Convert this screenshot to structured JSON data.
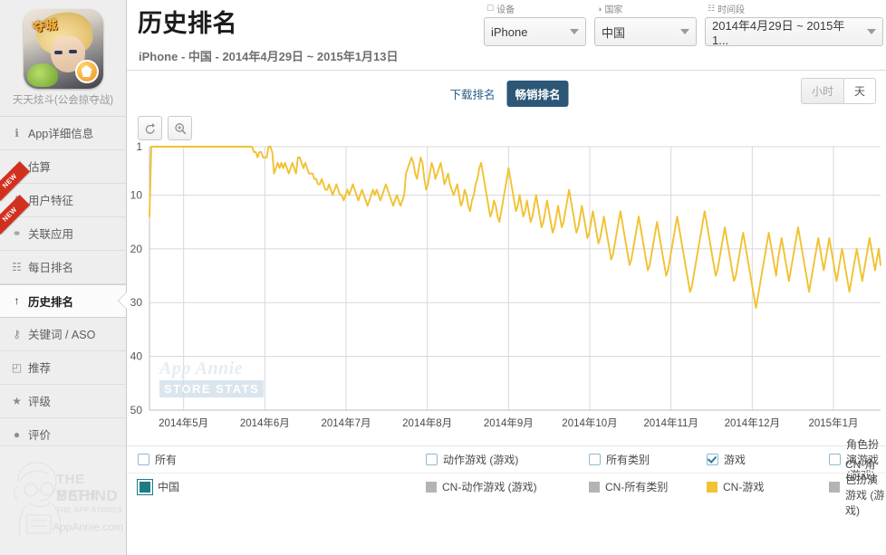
{
  "sidebar": {
    "app_name": "天天炫斗(公会掠夺战)",
    "app_icon_banner": "夺城",
    "items": [
      {
        "label": "App详细信息",
        "icon": "info-icon",
        "glyph": "ℹ",
        "new": false,
        "active": false
      },
      {
        "label": "估算",
        "icon": "chart-line-icon",
        "glyph": "↗",
        "new": false,
        "active": false
      },
      {
        "label": "用户特征",
        "icon": "user-icon",
        "glyph": "♟",
        "new": true,
        "active": false
      },
      {
        "label": "关联应用",
        "icon": "link-apps-icon",
        "glyph": "⚭",
        "new": true,
        "active": false
      },
      {
        "label": "每日排名",
        "icon": "calendar-icon",
        "glyph": "☷",
        "new": false,
        "active": false
      },
      {
        "label": "历史排名",
        "icon": "up-arrow-icon",
        "glyph": "↑",
        "new": false,
        "active": true
      },
      {
        "label": "关键词 / ASO",
        "icon": "key-icon",
        "glyph": "⚷",
        "new": false,
        "active": false
      },
      {
        "label": "推荐",
        "icon": "bookmark-icon",
        "glyph": "◰",
        "new": false,
        "active": false
      },
      {
        "label": "评级",
        "icon": "star-icon",
        "glyph": "★",
        "new": false,
        "active": false
      },
      {
        "label": "评价",
        "icon": "comment-icon",
        "glyph": "●",
        "new": false,
        "active": false
      }
    ],
    "brand": {
      "line1": "THE MATH",
      "line2": "BEHIND",
      "line3": "THE APP STORES",
      "line4": "AppAnnie.com"
    },
    "new_badge_text": "NEW"
  },
  "header": {
    "title": "历史排名",
    "subtitle": "iPhone - 中国 - 2014年4月29日 ~ 2015年1月13日",
    "selectors": [
      {
        "label": "设备",
        "icon": "device-icon",
        "glyph": "☐",
        "value": "iPhone",
        "width": "sel-w1"
      },
      {
        "label": "国家",
        "icon": "globe-icon",
        "glyph": "◑",
        "value": "中国",
        "width": "sel-w2"
      },
      {
        "label": "时间段",
        "icon": "calendar-icon",
        "glyph": "☷",
        "value": "2014年4月29日 ~ 2015年1...",
        "width": "sel-w3"
      }
    ]
  },
  "toolbar": {
    "tabs": [
      {
        "label": "下载排名",
        "active": false
      },
      {
        "label": "畅销排名",
        "active": true
      }
    ],
    "units": [
      {
        "label": "小时",
        "active": false
      },
      {
        "label": "天",
        "active": true
      }
    ],
    "chart_buttons": [
      {
        "name": "reset-zoom-button",
        "icon": "undo-icon"
      },
      {
        "name": "zoom-in-button",
        "icon": "magnifier-plus-icon"
      }
    ]
  },
  "watermark": {
    "line1": "App Annie",
    "line2": "STORE STATS"
  },
  "legend": {
    "checkboxes": [
      {
        "label": "所有",
        "checked": false
      },
      {
        "label": "动作游戏 (游戏)",
        "checked": false
      },
      {
        "label": "所有类别",
        "checked": false
      },
      {
        "label": "游戏",
        "checked": true
      },
      {
        "label": "角色扮演游戏 (游戏)",
        "checked": false
      }
    ],
    "series_legend": [
      {
        "label": "中国",
        "color": "#1d7b86",
        "style": "teal"
      },
      {
        "label": "CN-动作游戏 (游戏)",
        "color": "#b4b4b4",
        "style": "flat"
      },
      {
        "label": "CN-所有类别",
        "color": "#b4b4b4",
        "style": "flat"
      },
      {
        "label": "CN-游戏",
        "color": "#f1c232",
        "style": "flat"
      },
      {
        "label": "CN-角色扮演游戏 (游戏)",
        "color": "#b4b4b4",
        "style": "flat"
      }
    ]
  },
  "chart_data": {
    "type": "line",
    "title": "历史排名",
    "xlabel": "",
    "ylabel": "",
    "ylim": [
      1,
      50
    ],
    "y_inverted": true,
    "yticks": [
      1,
      10,
      20,
      30,
      40,
      50
    ],
    "xticks": [
      "2014年5月",
      "2014年6月",
      "2014年7月",
      "2014年8月",
      "2014年9月",
      "2014年10月",
      "2014年11月",
      "2014年12月",
      "2015年1月"
    ],
    "x_range": [
      "2014年4月29日",
      "2015年1月13日"
    ],
    "grid": true,
    "legend_position": "bottom",
    "line_color": "#f1c232",
    "series": [
      {
        "name": "CN-游戏",
        "color": "#f1c232",
        "values": [
          14,
          1,
          1,
          1,
          1,
          1,
          1,
          1,
          1,
          1,
          1,
          1,
          1,
          1,
          1,
          1,
          1,
          1,
          1,
          1,
          1,
          1,
          1,
          1,
          1,
          1,
          1,
          1,
          1,
          1,
          1,
          1,
          1,
          1,
          1,
          1,
          1,
          1,
          1,
          1,
          1,
          1,
          1,
          1,
          1,
          1,
          1,
          1,
          1,
          1,
          1,
          1,
          1,
          1,
          1,
          1,
          1,
          2,
          2,
          3,
          2,
          2,
          3,
          3,
          3,
          1,
          1,
          2,
          6,
          5,
          4,
          5,
          4,
          5,
          4,
          5,
          6,
          5,
          4,
          5,
          6,
          3,
          3,
          4,
          5,
          4,
          5,
          6,
          6,
          6,
          7,
          7,
          8,
          8,
          7,
          8,
          9,
          9,
          8,
          9,
          10,
          9,
          8,
          9,
          10,
          10,
          11,
          10,
          9,
          10,
          9,
          8,
          9,
          10,
          11,
          10,
          9,
          10,
          11,
          12,
          11,
          10,
          9,
          10,
          9,
          10,
          11,
          10,
          9,
          8,
          9,
          10,
          11,
          12,
          11,
          10,
          11,
          12,
          11,
          10,
          6,
          5,
          4,
          3,
          4,
          6,
          7,
          5,
          3,
          4,
          7,
          9,
          8,
          6,
          4,
          5,
          7,
          6,
          5,
          4,
          6,
          8,
          7,
          6,
          8,
          9,
          10,
          9,
          8,
          10,
          12,
          11,
          9,
          10,
          12,
          13,
          11,
          10,
          8,
          7,
          5,
          4,
          6,
          8,
          10,
          12,
          14,
          13,
          11,
          12,
          14,
          15,
          13,
          11,
          9,
          7,
          5,
          7,
          9,
          11,
          13,
          12,
          10,
          12,
          14,
          13,
          11,
          13,
          15,
          14,
          12,
          10,
          12,
          14,
          16,
          15,
          13,
          11,
          13,
          15,
          17,
          16,
          14,
          12,
          14,
          16,
          15,
          13,
          11,
          9,
          11,
          13,
          15,
          17,
          16,
          14,
          12,
          14,
          16,
          18,
          17,
          15,
          13,
          15,
          17,
          19,
          18,
          16,
          14,
          16,
          18,
          20,
          22,
          21,
          19,
          17,
          15,
          13,
          15,
          17,
          19,
          21,
          23,
          22,
          20,
          18,
          16,
          14,
          16,
          18,
          20,
          22,
          24,
          23,
          21,
          19,
          17,
          15,
          17,
          19,
          21,
          23,
          25,
          24,
          22,
          20,
          18,
          16,
          14,
          16,
          18,
          20,
          22,
          24,
          26,
          28,
          27,
          25,
          23,
          21,
          19,
          17,
          15,
          13,
          15,
          17,
          19,
          21,
          23,
          25,
          24,
          22,
          20,
          18,
          16,
          18,
          20,
          22,
          24,
          26,
          25,
          23,
          21,
          19,
          17,
          19,
          21,
          23,
          25,
          27,
          29,
          31,
          29,
          27,
          25,
          23,
          21,
          19,
          17,
          19,
          21,
          23,
          25,
          22,
          20,
          18,
          20,
          22,
          24,
          26,
          24,
          22,
          20,
          18,
          16,
          18,
          20,
          22,
          24,
          26,
          28,
          26,
          24,
          22,
          20,
          18,
          20,
          22,
          24,
          22,
          20,
          18,
          20,
          22,
          24,
          26,
          24,
          22,
          20,
          22,
          24,
          26,
          28,
          26,
          24,
          22,
          20,
          22,
          24,
          26,
          24,
          22,
          20,
          18,
          20,
          22,
          24,
          22,
          20,
          23
        ]
      }
    ]
  }
}
